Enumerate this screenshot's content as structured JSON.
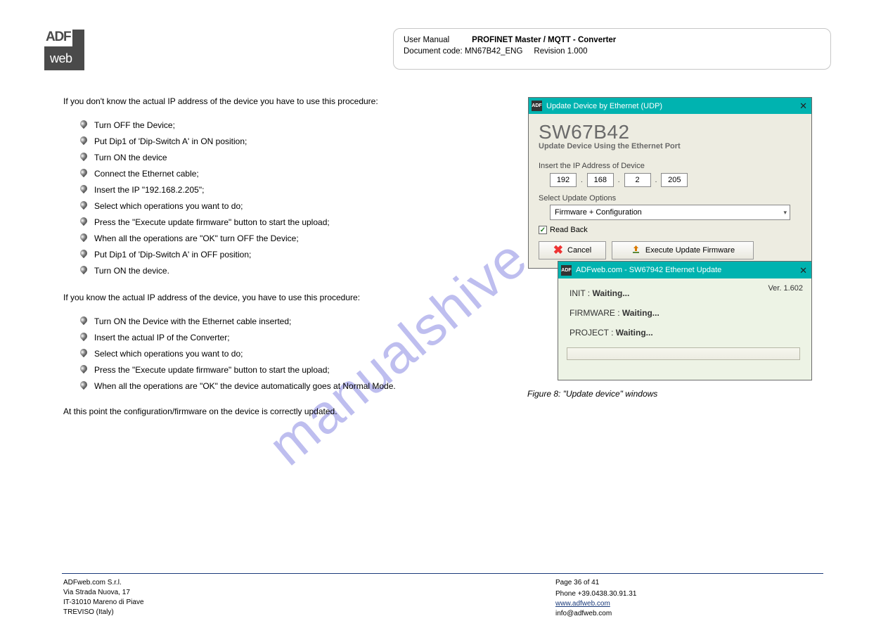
{
  "logo": {
    "top": "ADF",
    "bottom": "web"
  },
  "header": {
    "l1": "User Manual",
    "l2_label": "Revision",
    "l2_val": "1.000",
    "l3_label": "Document code:",
    "l3_val": "MN67B42_ENG",
    "product": "PROFINET Master / MQTT - Converter"
  },
  "intro": {
    "p1a": "If you don't know the actual IP address of the device you have to use this procedure:",
    "steps_a": [
      "Turn OFF the Device;",
      "Put Dip1 of 'Dip-Switch A' in ON position;",
      "Turn ON the device",
      "Connect the Ethernet cable;",
      "Insert the IP \"192.168.2.205\";",
      "Select which operations you want to do;",
      "Press the \"Execute update firmware\" button to start the upload;",
      "When all the operations are \"OK\" turn OFF the Device;",
      "Put Dip1 of 'Dip-Switch A' in OFF position;",
      "Turn ON the device."
    ],
    "p1b": "If you know the actual IP address of the device, you have to use this procedure:",
    "steps_b": [
      "Turn ON the Device with the Ethernet cable inserted;",
      "Insert the actual IP of the Converter;",
      "Select which operations you want to do;",
      "Press the \"Execute update firmware\" button to start the upload;",
      "When all the operations are \"OK\" the device automatically goes at Normal Mode."
    ],
    "p2": "At this point the configuration/firmware on the device is correctly updated."
  },
  "dlg1": {
    "title_bar": "Update Device by Ethernet (UDP)",
    "h1": "SW67B42",
    "sub": "Update Device Using the Ethernet Port",
    "ip_label": "Insert the IP Address of Device",
    "ip": [
      "192",
      "168",
      "2",
      "205"
    ],
    "sel_label": "Select Update Options",
    "sel_value": "Firmware + Configuration",
    "readback": "Read Back",
    "btn_cancel": "Cancel",
    "btn_exec": "Execute Update Firmware"
  },
  "dlg2": {
    "title_bar": "ADFweb.com - SW67942 Ethernet Update",
    "ver": "Ver. 1.602",
    "rows": [
      {
        "label": "INIT : ",
        "val": "Waiting..."
      },
      {
        "label": "FIRMWARE : ",
        "val": "Waiting..."
      },
      {
        "label": "PROJECT : ",
        "val": "Waiting..."
      }
    ]
  },
  "figcap": "Figure 8: \"Update device\" windows",
  "footer": {
    "left_l1": "ADFweb.com  S.r.l.",
    "left_l2": "Via Strada Nuova, 17",
    "left_l3": "IT-31010  Mareno di Piave",
    "left_l4": "TREVISO (Italy)",
    "right_pg": "Page 36 of 41",
    "right_l1": "Phone  +39.0438.30.91.31",
    "right_l2": "www.adfweb.com",
    "right_l3": "info@adfweb.com"
  },
  "watermark": "manualshive.com"
}
